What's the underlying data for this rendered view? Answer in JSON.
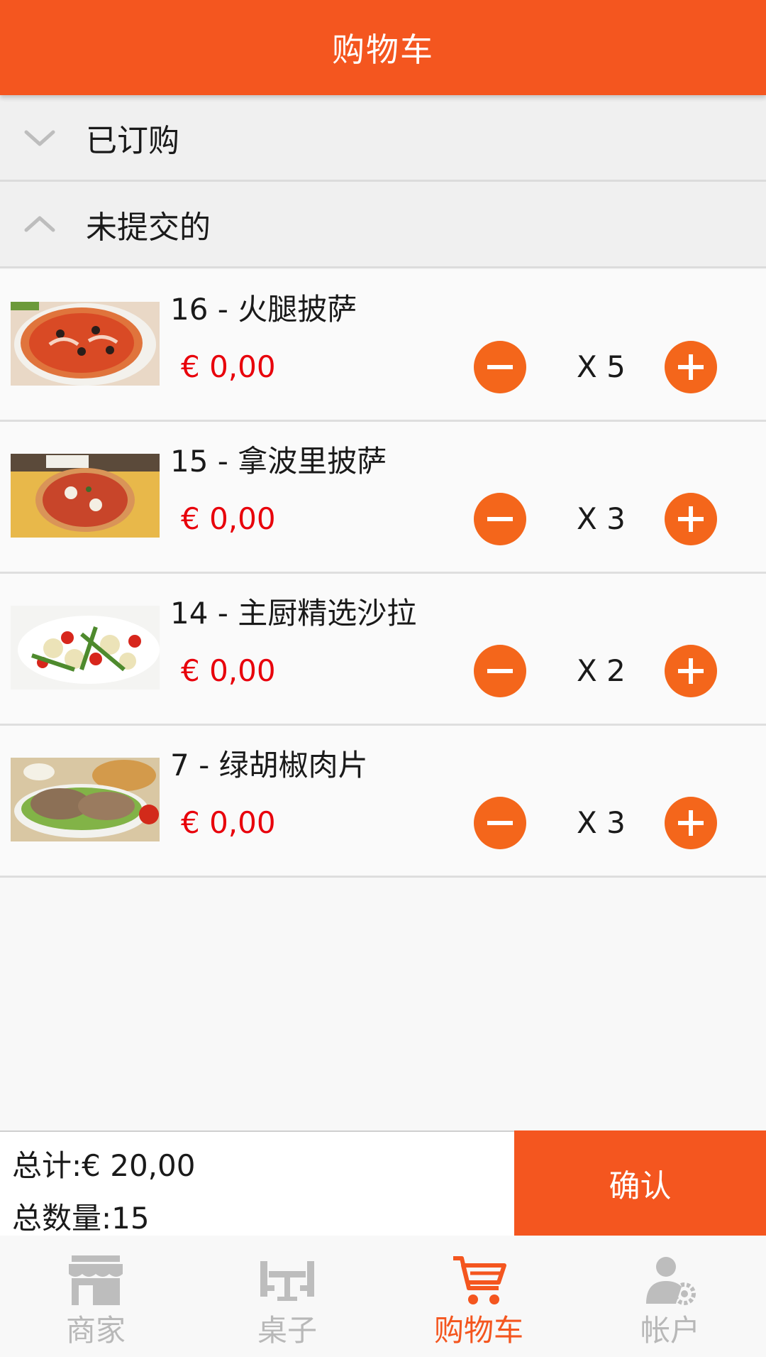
{
  "header": {
    "title": "购物车"
  },
  "sections": {
    "ordered": {
      "label": "已订购",
      "expanded": false
    },
    "unsubmitted": {
      "label": "未提交的",
      "expanded": true
    }
  },
  "items": [
    {
      "name": "16 - 火腿披萨",
      "price": "€ 0,00",
      "qty": "X 5",
      "thumb": "ham-pizza-image"
    },
    {
      "name": "15 - 拿波里披萨",
      "price": "€ 0,00",
      "qty": "X 3",
      "thumb": "napoli-pizza-image"
    },
    {
      "name": "14 - 主厨精选沙拉",
      "price": "€ 0,00",
      "qty": "X 2",
      "thumb": "chef-salad-image"
    },
    {
      "name": "7 - 绿胡椒肉片",
      "price": "€ 0,00",
      "qty": "X 3",
      "thumb": "green-pepper-steak-image"
    }
  ],
  "summary": {
    "total": "总计:€ 20,00",
    "count": "总数量:15",
    "confirm_label": "确认"
  },
  "nav": [
    {
      "label": "商家",
      "icon": "store-icon",
      "active": false
    },
    {
      "label": "桌子",
      "icon": "table-icon",
      "active": false
    },
    {
      "label": "购物车",
      "icon": "cart-icon",
      "active": true
    },
    {
      "label": "帐户",
      "icon": "account-settings-icon",
      "active": false
    }
  ],
  "colors": {
    "accent": "#f4561f",
    "button": "#f4661b",
    "price": "#e8000b",
    "inactive_nav": "#b8b8b8"
  }
}
